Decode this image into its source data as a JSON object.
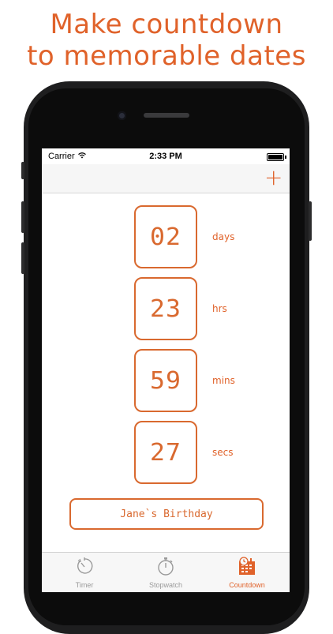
{
  "headline": {
    "line1": "Make countdown",
    "line2": "to memorable dates"
  },
  "statusbar": {
    "carrier": "Carrier",
    "time": "2:33 PM"
  },
  "navbar": {
    "add_label": "+"
  },
  "countdown": [
    {
      "value": "02",
      "unit": "days"
    },
    {
      "value": "23",
      "unit": "hrs"
    },
    {
      "value": "59",
      "unit": "mins"
    },
    {
      "value": "27",
      "unit": "secs"
    }
  ],
  "event": {
    "name": "Jane`s Birthday"
  },
  "tabs": [
    {
      "label": "Timer",
      "icon": "timer-icon",
      "active": false
    },
    {
      "label": "Stopwatch",
      "icon": "stopwatch-icon",
      "active": false
    },
    {
      "label": "Countdown",
      "icon": "countdown-calendar-icon",
      "active": true
    }
  ],
  "colors": {
    "accent": "#e0622a",
    "tab_inactive": "#9a9a9a"
  }
}
